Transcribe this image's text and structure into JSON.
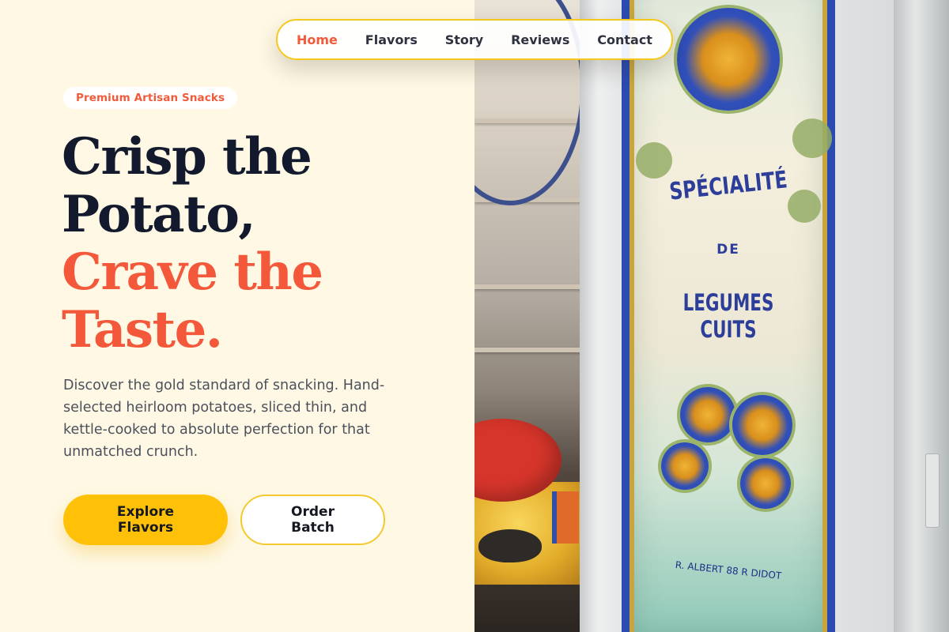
{
  "nav": {
    "items": [
      {
        "label": "Home",
        "active": true
      },
      {
        "label": "Flavors",
        "active": false
      },
      {
        "label": "Story",
        "active": false
      },
      {
        "label": "Reviews",
        "active": false
      },
      {
        "label": "Contact",
        "active": false
      }
    ]
  },
  "hero": {
    "badge": "Premium Artisan Snacks",
    "headline": {
      "line1": "Crisp the",
      "line2": "Potato,",
      "line3": "Crave the",
      "line4": "Taste."
    },
    "description": "Discover the gold standard of snacking. Hand-selected heirloom potatoes, sliced thin, and kettle-cooked to absolute perfection for that unmatched crunch.",
    "primary_button": "Explore Flavors",
    "secondary_button": "Order Batch"
  },
  "photo": {
    "sign_line1": "SPÉCIALITÉ",
    "sign_line2": "DE",
    "sign_line3": "LEGUMES CUITS",
    "sign_signature": "R. ALBERT 88 R DIDOT"
  },
  "colors": {
    "background": "#fef8e4",
    "accent": "#f4583a",
    "heading": "#131a2d",
    "button_primary": "#ffc107",
    "nav_border": "#f6c81c"
  }
}
